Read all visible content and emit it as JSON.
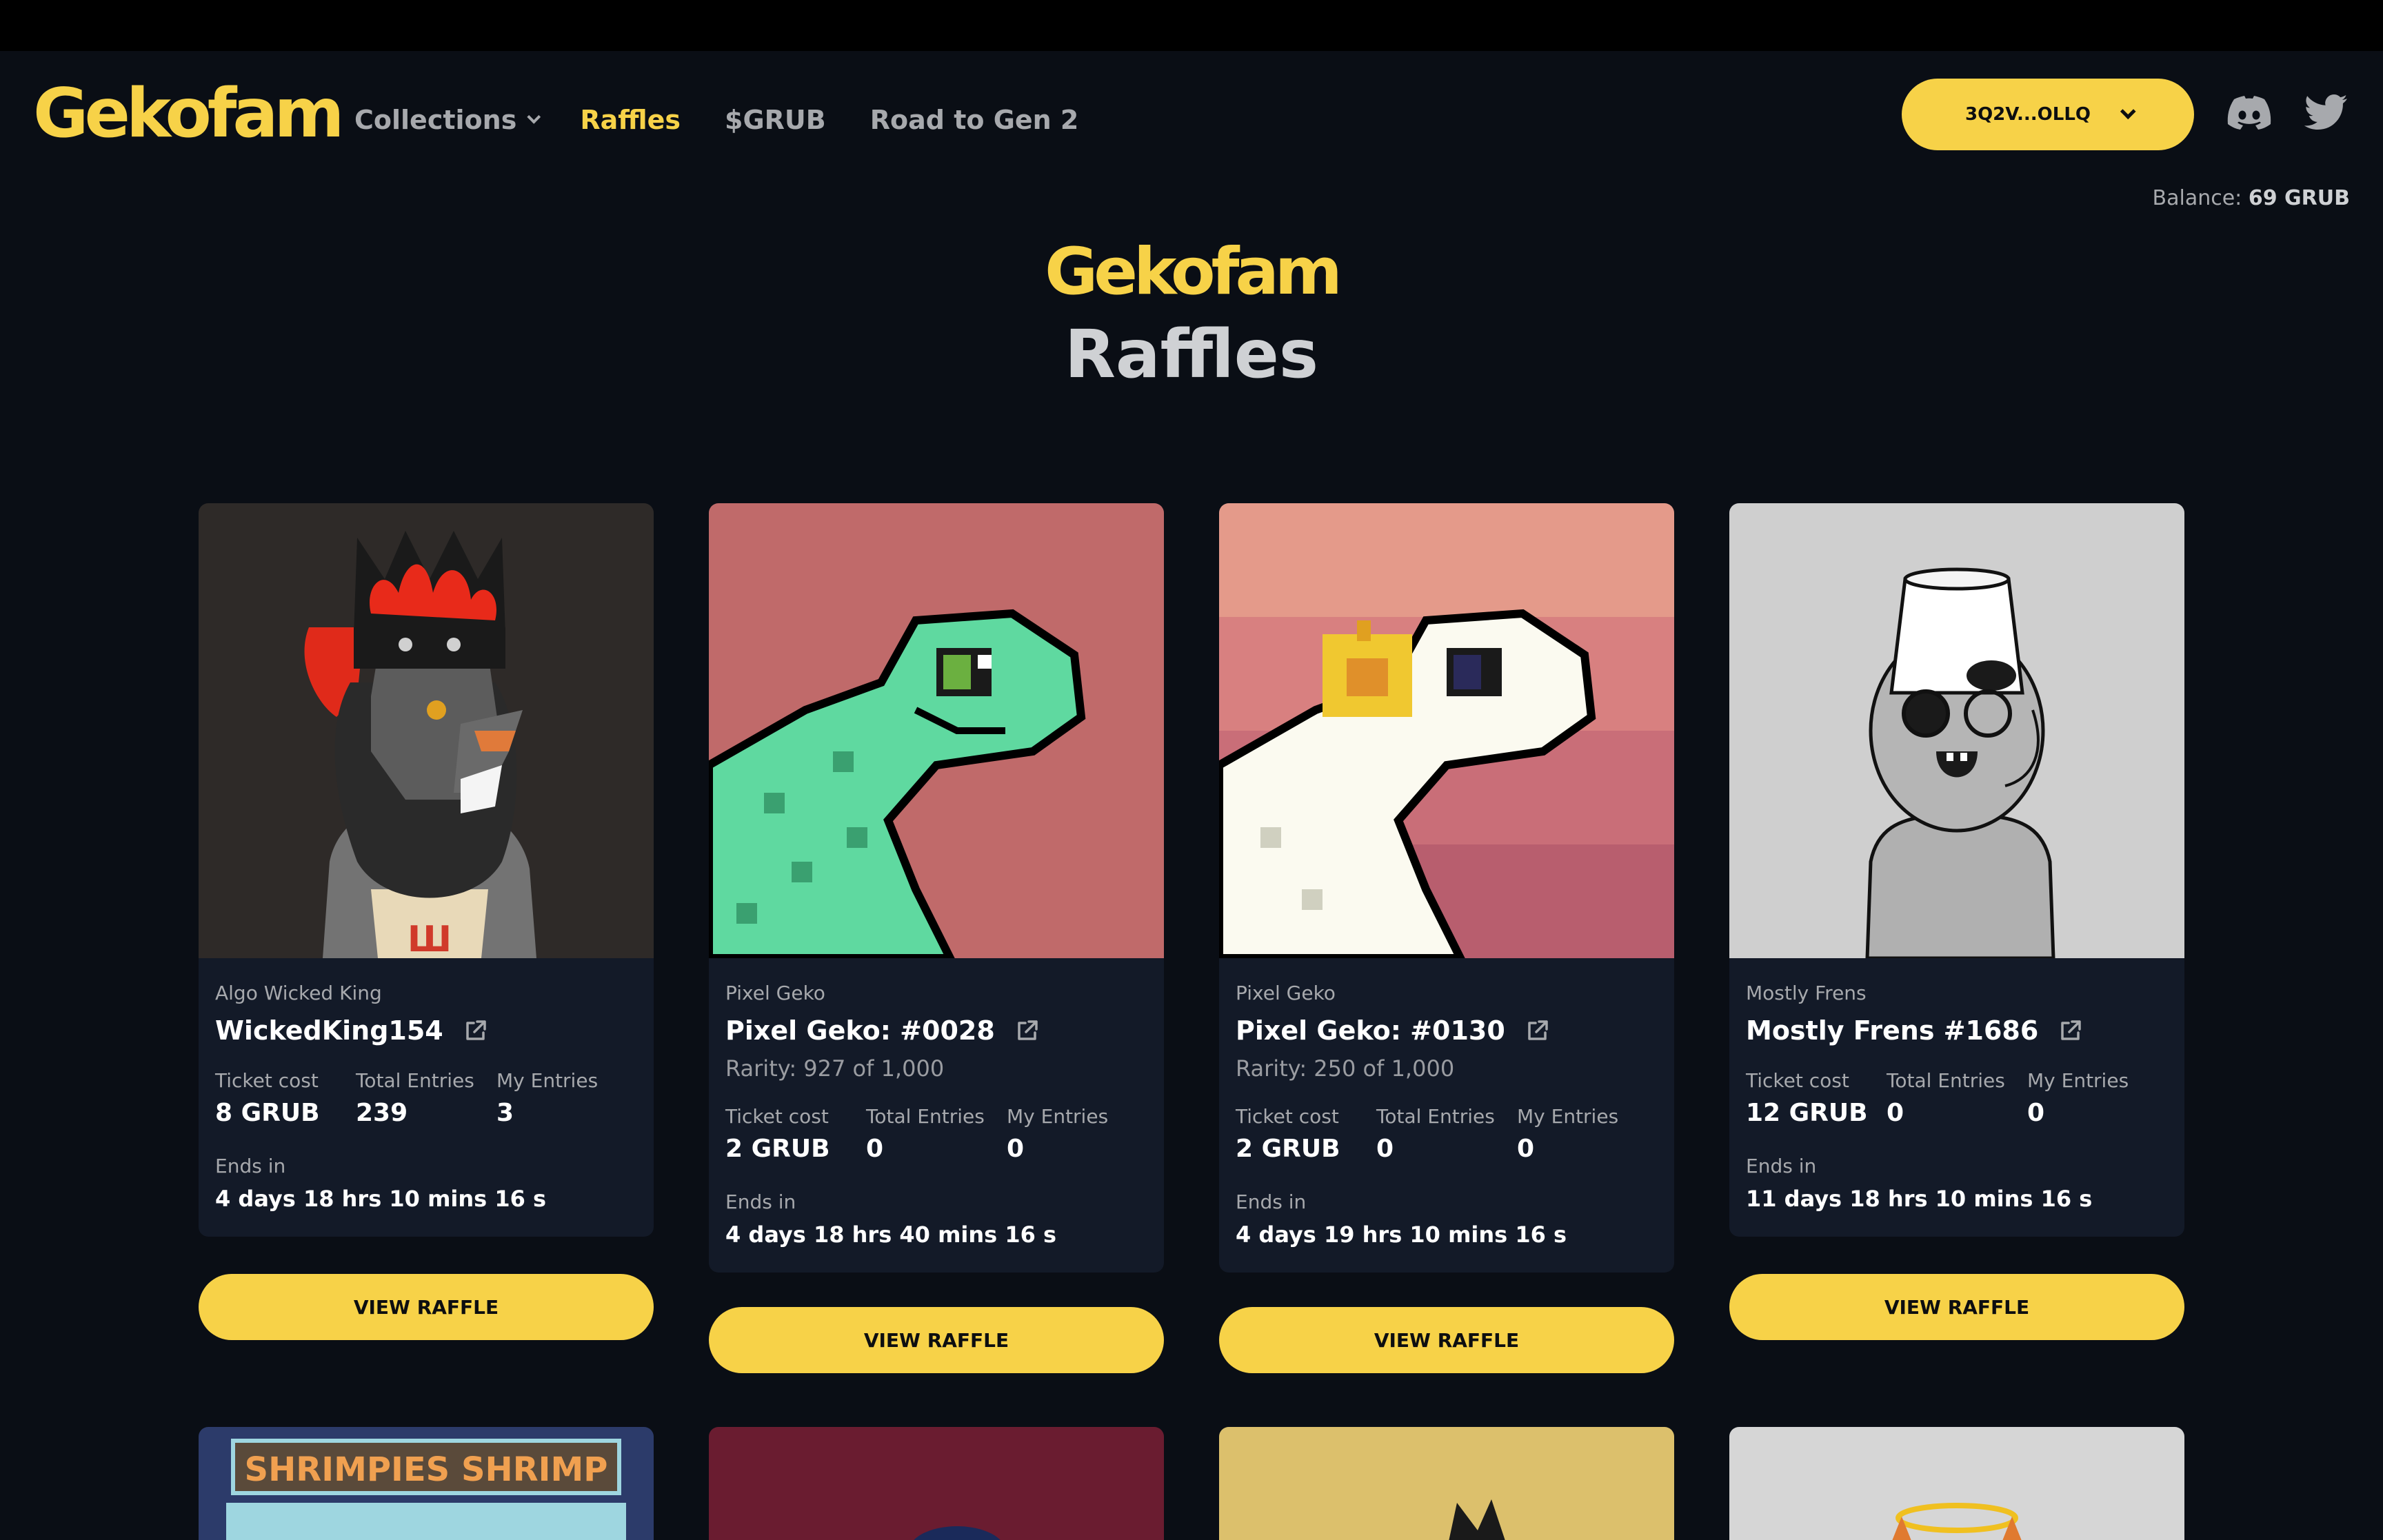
{
  "nav": {
    "logo": "Gekofam",
    "links": [
      {
        "label": "Collections"
      },
      {
        "label": "Raffles"
      },
      {
        "label": "$GRUB"
      },
      {
        "label": "Road to Gen 2"
      }
    ],
    "wallet": "3Q2V...OLLQ",
    "balance_label": "Balance:",
    "balance_value": "69 GRUB"
  },
  "hero": {
    "logo": "Gekofam",
    "title": "Raffles"
  },
  "labels": {
    "ticket_cost": "Ticket cost",
    "total_entries": "Total Entries",
    "my_entries": "My Entries",
    "ends_in": "Ends in",
    "view_raffle": "VIEW RAFFLE"
  },
  "cards": [
    {
      "collection": "Algo Wicked King",
      "title": "WickedKing154",
      "rarity": "",
      "ticket_cost": "8 GRUB",
      "total_entries": "239",
      "my_entries": "3",
      "ends_in": "4 days 18 hrs 10 mins 16 s"
    },
    {
      "collection": "Pixel Geko",
      "title": "Pixel Geko: #0028",
      "rarity": "Rarity: 927 of 1,000",
      "ticket_cost": "2 GRUB",
      "total_entries": "0",
      "my_entries": "0",
      "ends_in": "4 days 18 hrs 40 mins 16 s"
    },
    {
      "collection": "Pixel Geko",
      "title": "Pixel Geko: #0130",
      "rarity": "Rarity: 250 of 1,000",
      "ticket_cost": "2 GRUB",
      "total_entries": "0",
      "my_entries": "0",
      "ends_in": "4 days 19 hrs 10 mins 16 s"
    },
    {
      "collection": "Mostly Frens",
      "title": "Mostly Frens #1686",
      "rarity": "",
      "ticket_cost": "12 GRUB",
      "total_entries": "0",
      "my_entries": "0",
      "ends_in": "11 days 18 hrs 10 mins 16 s"
    }
  ],
  "next_row": {
    "first_tile_text": "SHRIMPIES SHRIMP"
  },
  "colors": {
    "accent": "#f7d248",
    "background": "#0a0e15",
    "card_body": "#131a28"
  },
  "icons": {
    "external_link": "external-link-icon",
    "discord": "discord-icon",
    "twitter": "twitter-icon",
    "dropdown": "chevron-down-icon"
  }
}
